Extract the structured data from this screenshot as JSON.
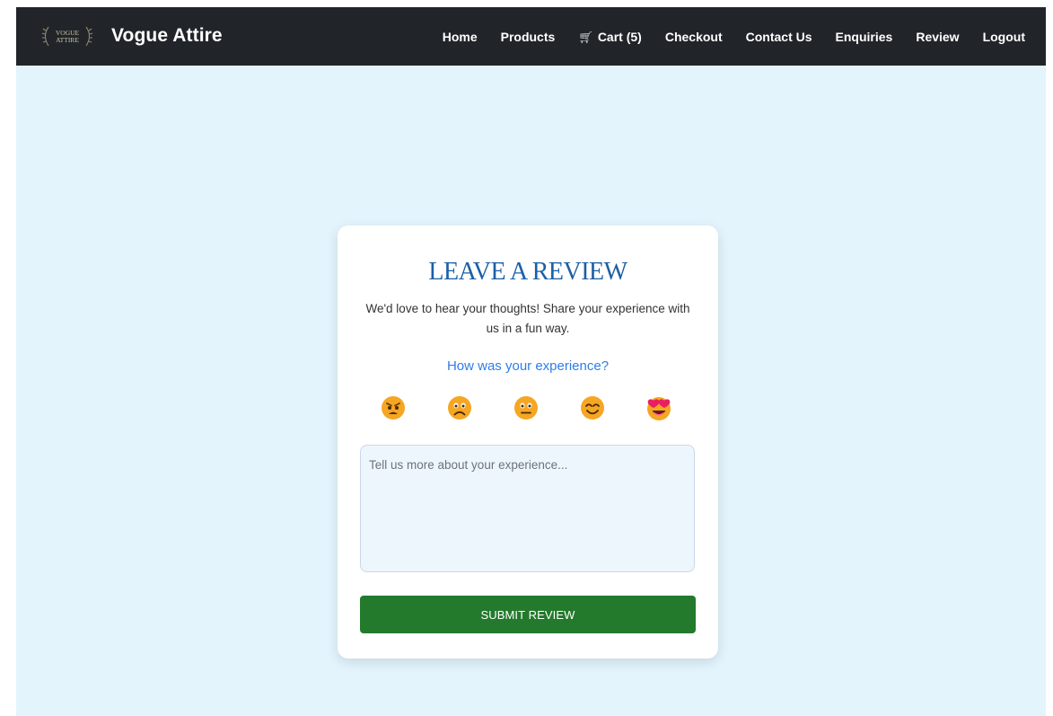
{
  "navbar": {
    "logo_icon": "vogue-attire-laurel-logo",
    "logo_text_line1": "VOGUE",
    "logo_text_line2": "ATTIRE",
    "brand": "Vogue Attire",
    "cart_icon": "cart-icon",
    "links": {
      "home": "Home",
      "products": "Products",
      "cart": "Cart (5)",
      "checkout": "Checkout",
      "contact": "Contact Us",
      "enquiries": "Enquiries",
      "review": "Review",
      "logout": "Logout"
    }
  },
  "review": {
    "title": "LEAVE A REVIEW",
    "description": "We'd love to hear your thoughts! Share your experience with us in a fun way.",
    "question": "How was your experience?",
    "emojis": [
      "angry-face-icon",
      "sad-face-icon",
      "neutral-face-icon",
      "smiling-face-icon",
      "heart-eyes-face-icon"
    ],
    "textarea_value": "",
    "textarea_placeholder": "Tell us more about your experience...",
    "submit_label": "SUBMIT REVIEW"
  },
  "colors": {
    "navbar_bg": "#212529",
    "page_bg": "#e3f4fd",
    "title": "#1c5fa6",
    "question": "#2d7ee8",
    "submit_bg": "#237a2c",
    "emoji_face": "#f5a623",
    "heart": "#e91e63"
  }
}
